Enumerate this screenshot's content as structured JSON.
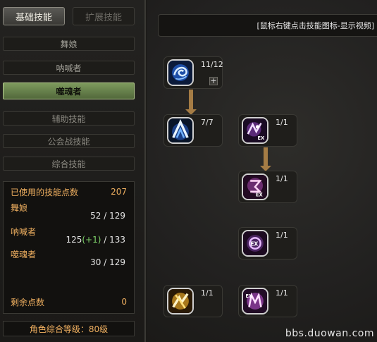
{
  "tabs": {
    "basic": "基础技能",
    "extended": "扩展技能"
  },
  "classes": {
    "dancer": "舞娘",
    "shouter": "呐喊者",
    "soul_eater": "噬魂者"
  },
  "categories": {
    "support": "辅助技能",
    "guild_war": "公会战技能",
    "general": "综合技能"
  },
  "stats": {
    "used_label": "已使用的技能点数",
    "used_value": "207",
    "dancer_label": "舞娘",
    "dancer_value": "52 / 129",
    "shouter_label": "呐喊者",
    "shouter_base": "125",
    "shouter_bonus": "(+1)",
    "shouter_max": " / 133",
    "soul_label": "噬魂者",
    "soul_value": "30 / 129",
    "remaining_label": "剩余点数",
    "remaining_value": "0"
  },
  "level_text": "角色综合等级：80级",
  "hint": "[鼠标右键点击技能图标-显示视频]",
  "skills": [
    {
      "level": "11/12",
      "icon": "wind-swirl-icon",
      "plus": "+"
    },
    {
      "level": "7/7",
      "icon": "blue-arch-icon"
    },
    {
      "level": "1/1",
      "icon": "ex-dance-icon"
    },
    {
      "level": "1/1",
      "icon": "ex-pink-icon"
    },
    {
      "level": "1/1",
      "icon": "ex-orb-icon"
    },
    {
      "level": "1/1",
      "icon": "golden-burst-icon"
    },
    {
      "level": "1/1",
      "icon": "ex-demon-icon"
    }
  ],
  "colors": {
    "accent_green": "#7d9a5d",
    "orange_text": "#f0b060",
    "bonus_green": "#7fd46a"
  },
  "watermark": "bbs.duowan.com"
}
